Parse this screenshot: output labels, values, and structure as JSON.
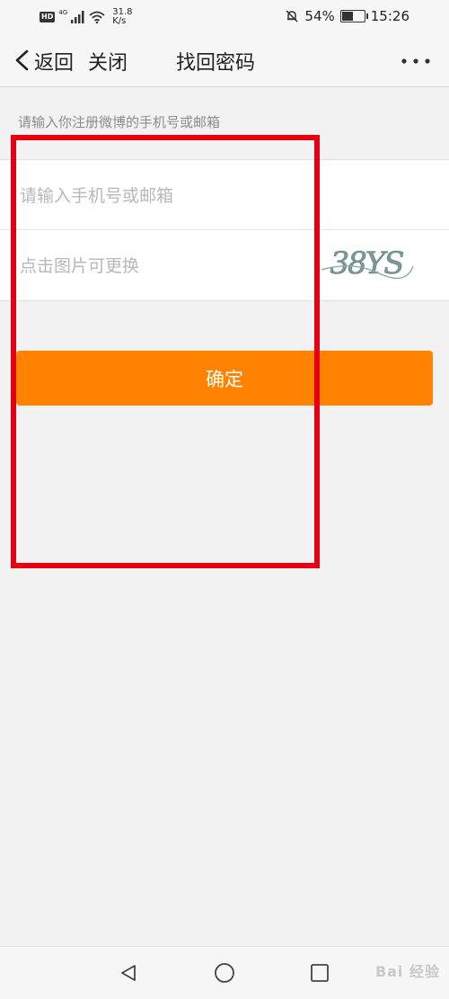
{
  "status_bar": {
    "hd": "HD",
    "network": "4G",
    "speed_value": "31.8",
    "speed_unit": "K/s",
    "battery_percent": "54%",
    "battery_level": 0.54,
    "time": "15:26"
  },
  "nav": {
    "back_label": "返回",
    "close_label": "关闭",
    "title": "找回密码"
  },
  "form": {
    "hint": "请输入你注册微博的手机号或邮箱",
    "account_placeholder": "请输入手机号或邮箱",
    "account_value": "",
    "captcha_placeholder": "点击图片可更换",
    "captcha_value": "",
    "captcha_image_text": "38YS"
  },
  "button": {
    "confirm_label": "确定"
  },
  "watermark": "Bai 经验",
  "colors": {
    "accent": "#ff8200",
    "annotation": "#e6000f",
    "background": "#f2f2f2"
  }
}
